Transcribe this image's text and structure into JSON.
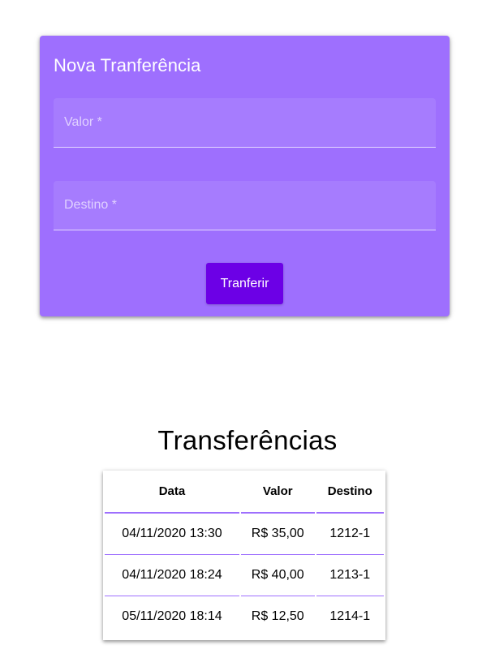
{
  "form": {
    "title": "Nova Tranferência",
    "valor_placeholder": "Valor *",
    "valor_value": "",
    "destino_placeholder": "Destino *",
    "destino_value": "",
    "submit_label": "Tranferir"
  },
  "transfers": {
    "title": "Transferências",
    "headers": [
      "Data",
      "Valor",
      "Destino"
    ],
    "rows": [
      [
        "04/11/2020 13:30",
        "R$ 35,00",
        "1212-1"
      ],
      [
        "04/11/2020 18:24",
        "R$ 40,00",
        "1213-1"
      ],
      [
        "05/11/2020 18:14",
        "R$ 12,50",
        "1214-1"
      ]
    ]
  },
  "colors": {
    "card_bg": "#9e6ffe",
    "button_bg": "#6c00e6",
    "row_divider": "#9e6ffe"
  }
}
